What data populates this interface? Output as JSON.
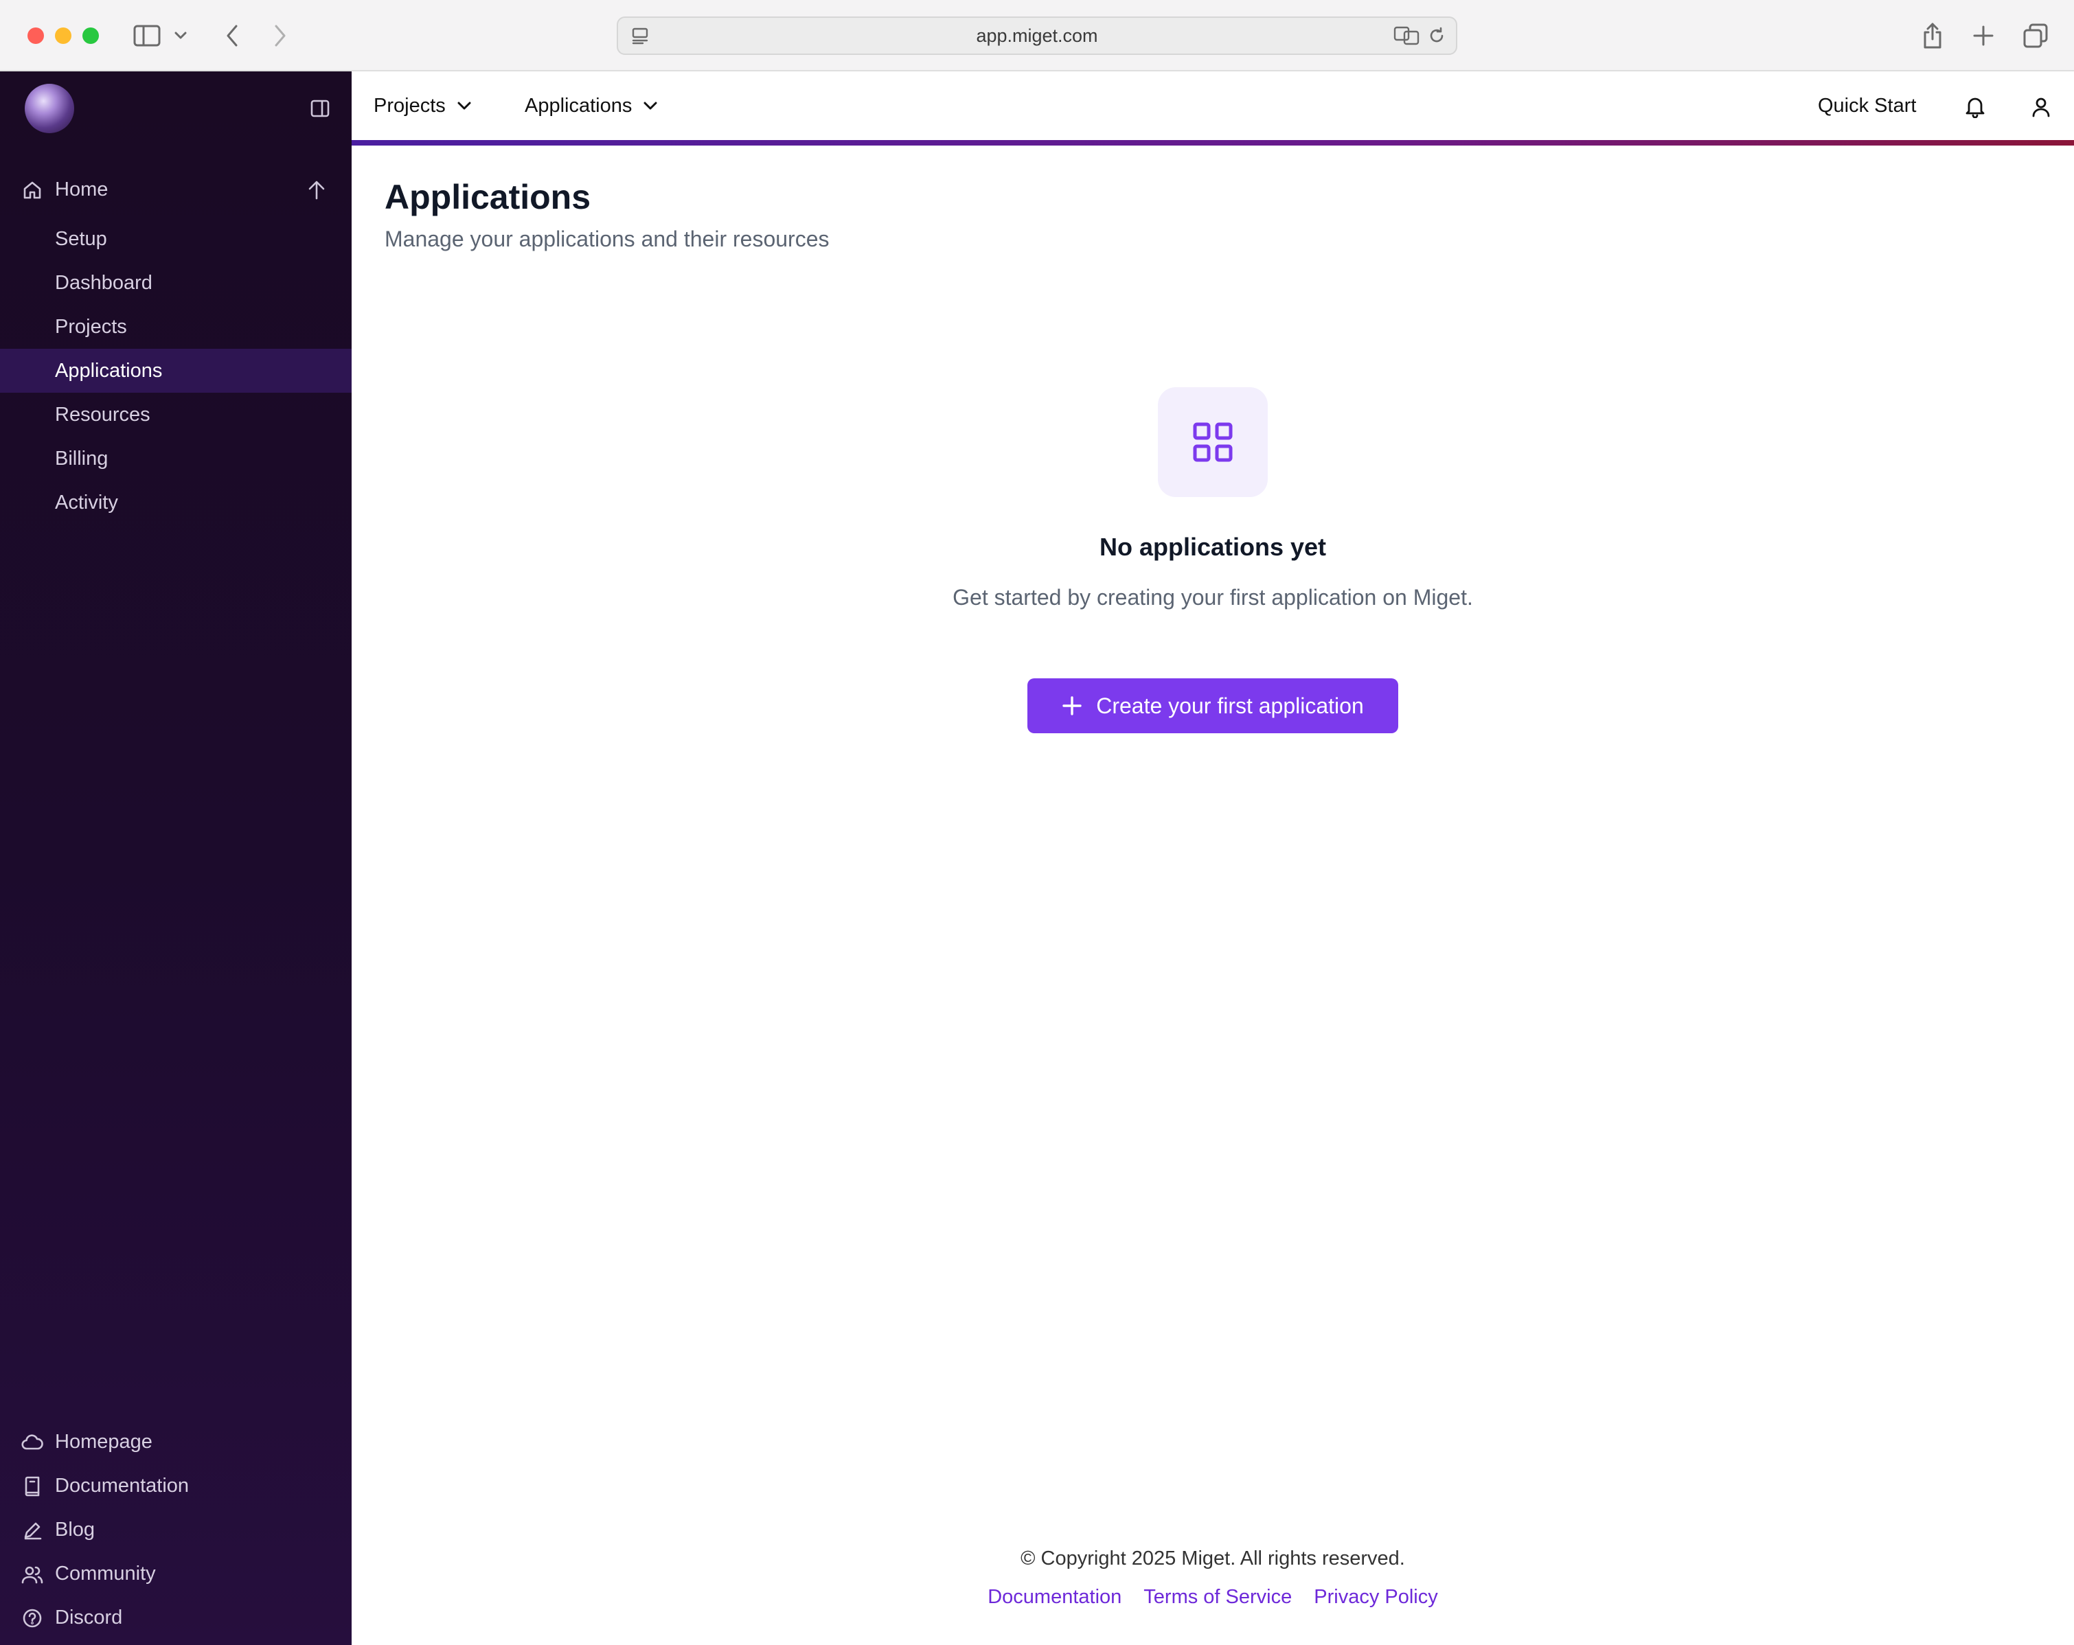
{
  "browser": {
    "url": "app.miget.com"
  },
  "sidebar": {
    "home": {
      "label": "Home"
    },
    "items": [
      {
        "label": "Setup"
      },
      {
        "label": "Dashboard"
      },
      {
        "label": "Projects"
      },
      {
        "label": "Applications",
        "active": true
      },
      {
        "label": "Resources"
      },
      {
        "label": "Billing"
      },
      {
        "label": "Activity"
      }
    ],
    "bottom": [
      {
        "label": "Homepage",
        "icon": "cloud-icon"
      },
      {
        "label": "Documentation",
        "icon": "book-icon"
      },
      {
        "label": "Blog",
        "icon": "pencil-icon"
      },
      {
        "label": "Community",
        "icon": "users-icon"
      },
      {
        "label": "Discord",
        "icon": "help-circle-icon"
      }
    ]
  },
  "topbar": {
    "projects_label": "Projects",
    "applications_label": "Applications",
    "quick_start_label": "Quick Start"
  },
  "page": {
    "title": "Applications",
    "subtitle": "Manage your applications and their resources"
  },
  "empty_state": {
    "title": "No applications yet",
    "description": "Get started by creating your first application on Miget.",
    "button_label": "Create your first application"
  },
  "footer": {
    "copyright": "© Copyright 2025 Miget. All rights reserved.",
    "links": [
      "Documentation",
      "Terms of Service",
      "Privacy Policy"
    ]
  },
  "colors": {
    "accent": "#7c3aed",
    "sidebar_bg": "#1c0b2c",
    "sidebar_active": "#2e1552"
  }
}
